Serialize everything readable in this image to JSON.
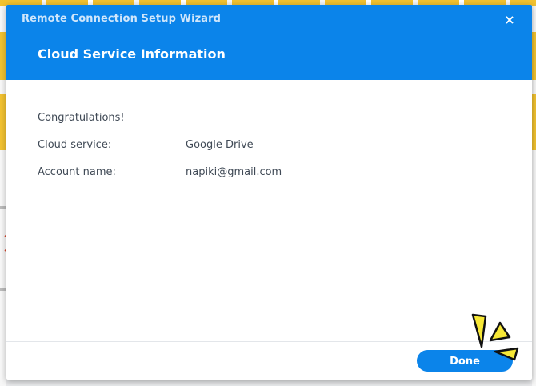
{
  "dialog": {
    "window_title": "Remote Connection Setup Wizard",
    "page_title": "Cloud Service Information",
    "close_icon": "×"
  },
  "content": {
    "congratulations": "Congratulations!",
    "rows": [
      {
        "label": "Cloud service:",
        "value": "Google Drive"
      },
      {
        "label": "Account name:",
        "value": "napiki@gmail.com"
      }
    ]
  },
  "footer": {
    "done_label": "Done"
  },
  "colors": {
    "accent": "#0b84ea",
    "burst_fill": "#f7e836"
  }
}
